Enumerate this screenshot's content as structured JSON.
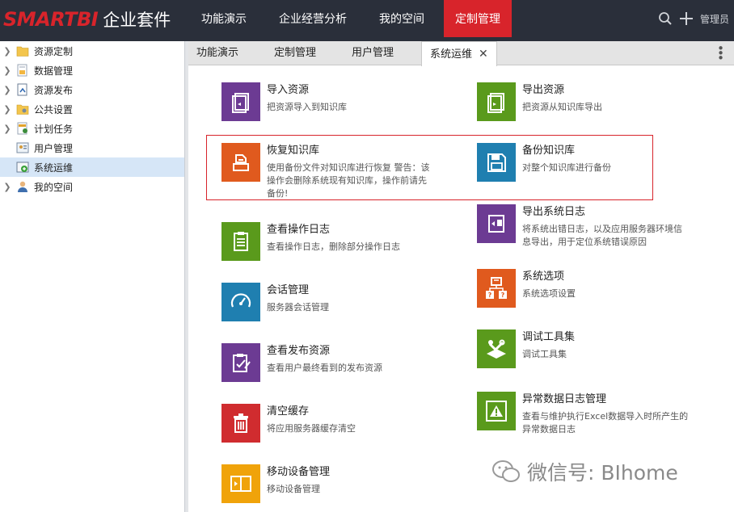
{
  "header": {
    "brand": "SMARTBI",
    "suite": "企业套件",
    "nav": [
      "功能演示",
      "企业经营分析",
      "我的空间",
      "定制管理"
    ],
    "active_nav": "定制管理",
    "user": "管理员"
  },
  "sidebar": {
    "items": [
      {
        "label": "资源定制",
        "icon": "folder-icon"
      },
      {
        "label": "数据管理",
        "icon": "data-doc-icon"
      },
      {
        "label": "资源发布",
        "icon": "publish-doc-icon"
      },
      {
        "label": "公共设置",
        "icon": "folder-settings-icon"
      },
      {
        "label": "计划任务",
        "icon": "schedule-icon"
      },
      {
        "label": "用户管理",
        "icon": "user-manage-icon"
      },
      {
        "label": "系统运维",
        "icon": "ops-icon"
      },
      {
        "label": "我的空间",
        "icon": "person-icon"
      }
    ]
  },
  "tabs": [
    {
      "label": "功能演示"
    },
    {
      "label": "定制管理"
    },
    {
      "label": "用户管理"
    },
    {
      "label": "系统运维"
    }
  ],
  "items": {
    "import": {
      "title": "导入资源",
      "desc": "把资源导入到知识库"
    },
    "export": {
      "title": "导出资源",
      "desc": "把资源从知识库导出"
    },
    "restore": {
      "title": "恢复知识库",
      "desc1": "使用备份文件对知识库进行恢复 警告：该",
      "desc2": "操作会删除系统现有知识库，操作前请先",
      "desc3": "备份!"
    },
    "backup": {
      "title": "备份知识库",
      "desc": "对整个知识库进行备份"
    },
    "exportlog": {
      "title": "导出系统日志",
      "desc1": "将系统出错日志，以及应用服务器环境信",
      "desc2": "息导出，用于定位系统错误原因"
    },
    "oplog": {
      "title": "查看操作日志",
      "desc": "查看操作日志，删除部分操作日志"
    },
    "options": {
      "title": "系统选项",
      "desc": "系统选项设置"
    },
    "session": {
      "title": "会话管理",
      "desc": "服务器会话管理"
    },
    "debug": {
      "title": "调试工具集",
      "desc": "调试工具集"
    },
    "published": {
      "title": "查看发布资源",
      "desc": "查看用户最终看到的发布资源"
    },
    "abnormal": {
      "title": "异常数据日志管理",
      "desc1": "查看与维护执行Excel数据导入时所产生的",
      "desc2": "异常数据日志"
    },
    "cache": {
      "title": "清空缓存",
      "desc": "将应用服务器缓存清空"
    },
    "mobile": {
      "title": "移动设备管理",
      "desc": "移动设备管理"
    }
  },
  "colors": {
    "purple": "#6c3b93",
    "green": "#5a9a1c",
    "orange": "#e05a1e",
    "blue": "#1f7fb0",
    "red": "#d02c2f",
    "yellow": "#f0a30a",
    "accent": "#d8242b"
  },
  "watermark": "微信号: BIhome"
}
